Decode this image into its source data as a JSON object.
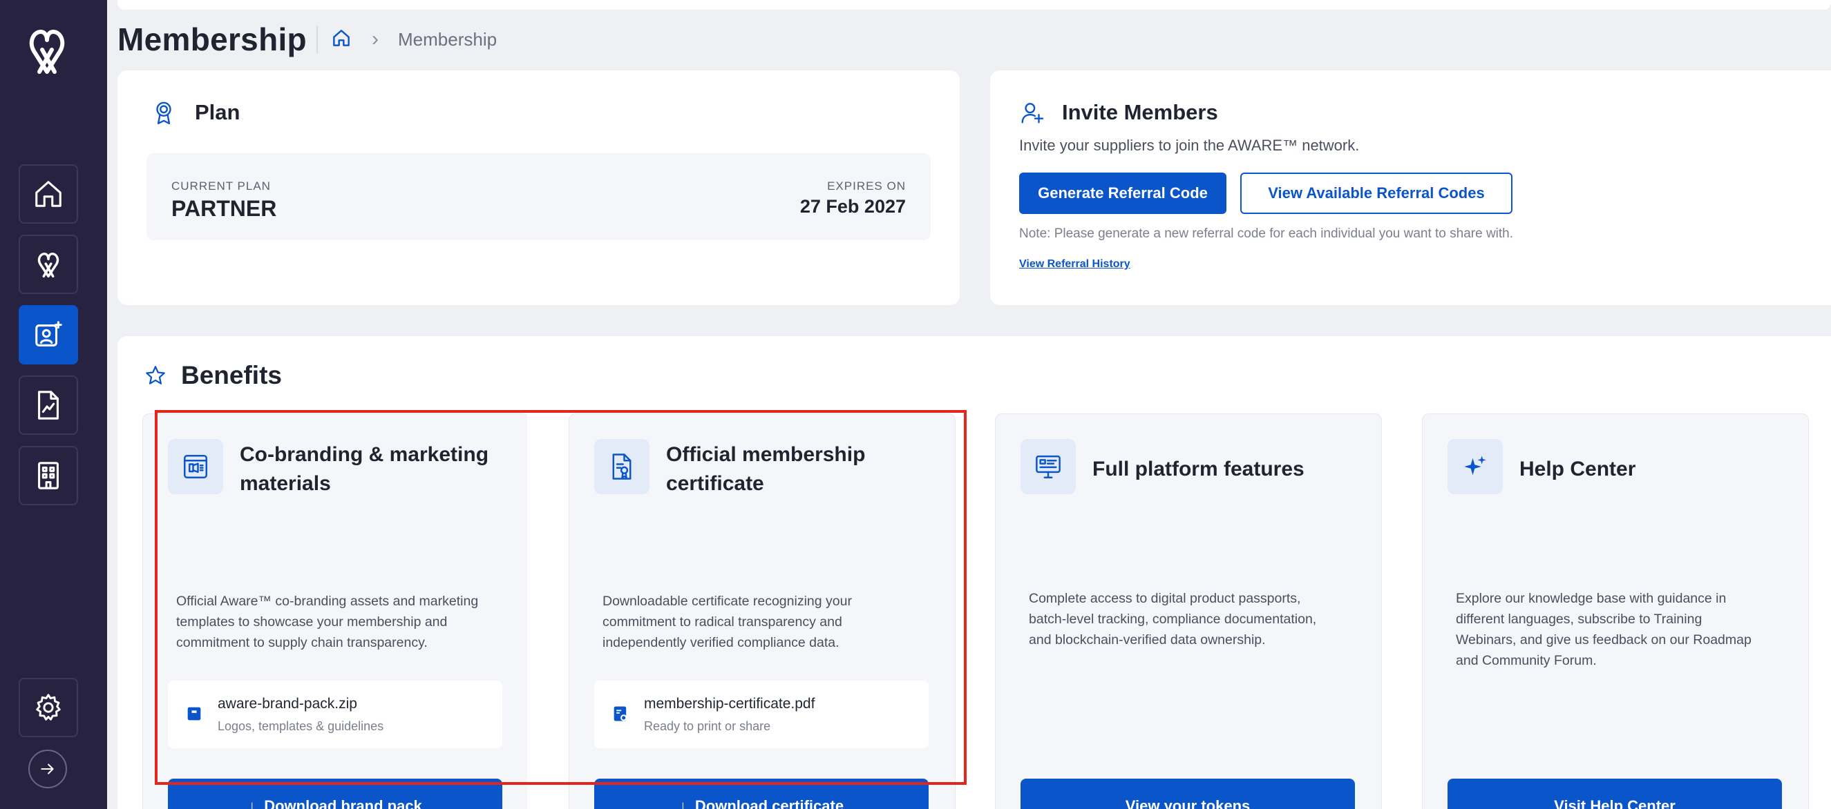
{
  "page": {
    "title": "Membership"
  },
  "breadcrumb": {
    "current": "Membership"
  },
  "sidebar": {
    "items": [
      {
        "name": "home-icon"
      },
      {
        "name": "aware-logo-icon"
      },
      {
        "name": "membership-icon",
        "active": true
      },
      {
        "name": "report-icon"
      },
      {
        "name": "building-icon"
      }
    ],
    "bottom": [
      {
        "name": "settings-icon"
      },
      {
        "name": "arrow-right-icon"
      }
    ]
  },
  "plan": {
    "title": "Plan",
    "current_label": "CURRENT PLAN",
    "current_value": "PARTNER",
    "expires_label": "EXPIRES ON",
    "expires_value": "27 Feb 2027"
  },
  "invite": {
    "title": "Invite Members",
    "subtitle": "Invite your suppliers to join the AWARE™ network.",
    "generate_label": "Generate Referral Code",
    "view_codes_label": "View Available Referral Codes",
    "note": "Note: Please generate a new referral code for each individual you want to share with.",
    "history_link": "View Referral History"
  },
  "benefits": {
    "title": "Benefits",
    "cards": [
      {
        "title_line1": "Co-branding & marketing",
        "title_line2": "materials",
        "desc_line1": "Official Aware™ co-branding assets and marketing",
        "desc_line2": "templates to showcase your membership and",
        "desc_line3": "commitment to supply chain transparency.",
        "file_name": "aware-brand-pack.zip",
        "file_sub": "Logos, templates & guidelines",
        "button": "Download brand pack"
      },
      {
        "title_line1": "Official membership",
        "title_line2": "certificate",
        "desc_line1": "Downloadable certificate recognizing your",
        "desc_line2": "commitment to radical transparency and",
        "desc_line3": "independently verified compliance data.",
        "file_name": "membership-certificate.pdf",
        "file_sub": "Ready to print or share",
        "button": "Download certificate"
      },
      {
        "title_line1": "Full platform features",
        "desc_line1": "Complete access to digital product passports,",
        "desc_line2": "batch-level tracking, compliance documentation,",
        "desc_line3": "and blockchain-verified data ownership.",
        "button": "View your tokens"
      },
      {
        "title_line1": "Help Center",
        "desc_line1": "Explore our knowledge base with guidance in",
        "desc_line2": "different languages, subscribe to Training",
        "desc_line3": "Webinars, and give us feedback on our Roadmap",
        "desc_line4": "and Community Forum.",
        "button": "Visit Help Center"
      }
    ]
  },
  "colors": {
    "sidebar": "#26223f",
    "primary": "#0a55c9",
    "highlight": "#e3261b"
  }
}
